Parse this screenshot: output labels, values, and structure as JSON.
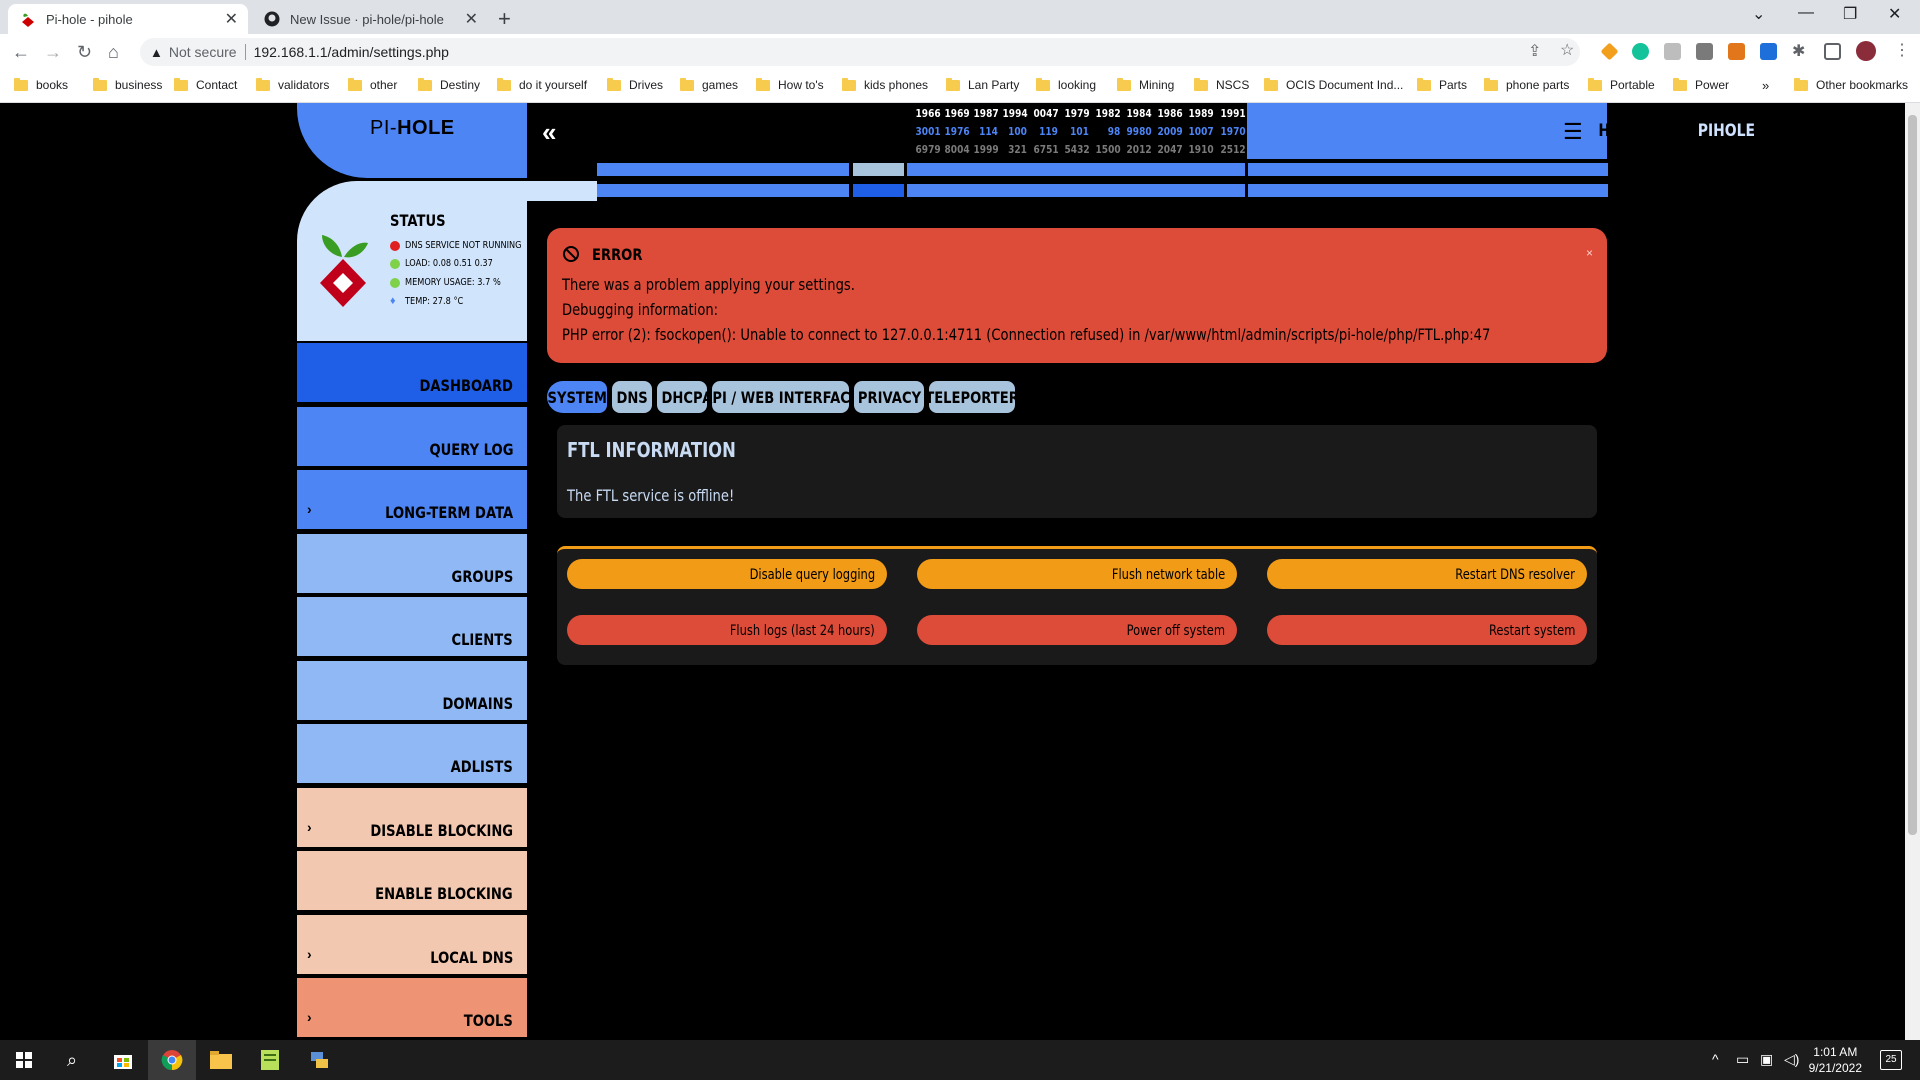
{
  "browser": {
    "tabs": [
      {
        "title": "Pi-hole - pihole",
        "active": true
      },
      {
        "title": "New Issue · pi-hole/pi-hole",
        "active": false
      }
    ],
    "security_label": "Not secure",
    "url": "192.168.1.1/admin/settings.php",
    "bookmarks": [
      "books",
      "business",
      "Contact",
      "validators",
      "other",
      "Destiny",
      "do it yourself",
      "Drives",
      "games",
      "How to's",
      "kids phones",
      "Lan Party",
      "looking",
      "Mining",
      "NSCS",
      "OCIS Document Ind...",
      "Parts",
      "phone parts",
      "Portable",
      "Power"
    ],
    "bookmarks_overflow": "»",
    "other_bookmarks": "Other bookmarks"
  },
  "header": {
    "logo_prefix": "PI-",
    "logo_bold": "HOLE",
    "collapse_glyph": "«",
    "hostname_label": "HOSTNAME:",
    "hostname_value": "PIHOLE",
    "columns": [
      {
        "top": "1966",
        "mid": "3001",
        "bot": "6979"
      },
      {
        "top": "1969",
        "mid": "1976",
        "bot": "8004"
      },
      {
        "top": "1987",
        "mid": "114",
        "bot": "1999"
      },
      {
        "top": "1994",
        "mid": "100",
        "bot": "321"
      },
      {
        "top": "0047",
        "mid": "119",
        "bot": "6751"
      },
      {
        "top": "1979",
        "mid": "101",
        "bot": "5432"
      },
      {
        "top": "1982",
        "mid": "98",
        "bot": "1500"
      },
      {
        "top": "1984",
        "mid": "9980",
        "bot": "2012"
      },
      {
        "top": "1986",
        "mid": "2009",
        "bot": "2047"
      },
      {
        "top": "1989",
        "mid": "1007",
        "bot": "1910"
      },
      {
        "top": "1991",
        "mid": "1970",
        "bot": "2512"
      }
    ]
  },
  "status": {
    "title": "STATUS",
    "items": [
      {
        "text": "DNS SERVICE NOT RUNNING",
        "color": "#e02020"
      },
      {
        "text": "LOAD:  0.08  0.51  0.37",
        "color": "#7fd14a"
      },
      {
        "text": "MEMORY USAGE:  3.7 %",
        "color": "#7fd14a"
      },
      {
        "text": "TEMP: 27.8 °C",
        "color": "#4d85f5"
      }
    ]
  },
  "sidebar": {
    "items": [
      {
        "label": "DASHBOARD",
        "chevron": ""
      },
      {
        "label": "QUERY LOG",
        "chevron": ""
      },
      {
        "label": "LONG-TERM DATA",
        "chevron": "›"
      },
      {
        "label": "GROUPS",
        "chevron": ""
      },
      {
        "label": "CLIENTS",
        "chevron": ""
      },
      {
        "label": "DOMAINS",
        "chevron": ""
      },
      {
        "label": "ADLISTS",
        "chevron": ""
      },
      {
        "label": "DISABLE BLOCKING",
        "chevron": "›"
      },
      {
        "label": "ENABLE BLOCKING",
        "chevron": ""
      },
      {
        "label": "LOCAL DNS",
        "chevron": "›"
      },
      {
        "label": "TOOLS",
        "chevron": "›"
      }
    ]
  },
  "alert": {
    "title": "ERROR",
    "close": "×",
    "line1": "There was a problem applying your settings.",
    "line2": "Debugging information:",
    "line3": "PHP error (2): fsockopen(): Unable to connect to 127.0.0.1:4711 (Connection refused) in /var/www/html/admin/scripts/pi-hole/php/FTL.php:47"
  },
  "settings_tabs": [
    "SYSTEM",
    "DNS",
    "DHCP",
    "API / WEB INTERFACE",
    "PRIVACY",
    "TELEPORTER"
  ],
  "ftl": {
    "title": "FTL INFORMATION",
    "message": "The FTL service is offline!"
  },
  "actions": {
    "disable_query_logging": "Disable query logging",
    "flush_network_table": "Flush network table",
    "restart_dns_resolver": "Restart DNS resolver",
    "flush_logs": "Flush logs (last 24 hours)",
    "power_off": "Power off system",
    "restart_system": "Restart system"
  },
  "taskbar": {
    "time": "1:01 AM",
    "date": "9/21/2022",
    "notification_count": "25"
  },
  "colors": {
    "lcars_blue": "#4d85f5",
    "lcars_light": "#d0e4fb",
    "error_red": "#dd4b39",
    "warning_orange": "#f19b16"
  }
}
